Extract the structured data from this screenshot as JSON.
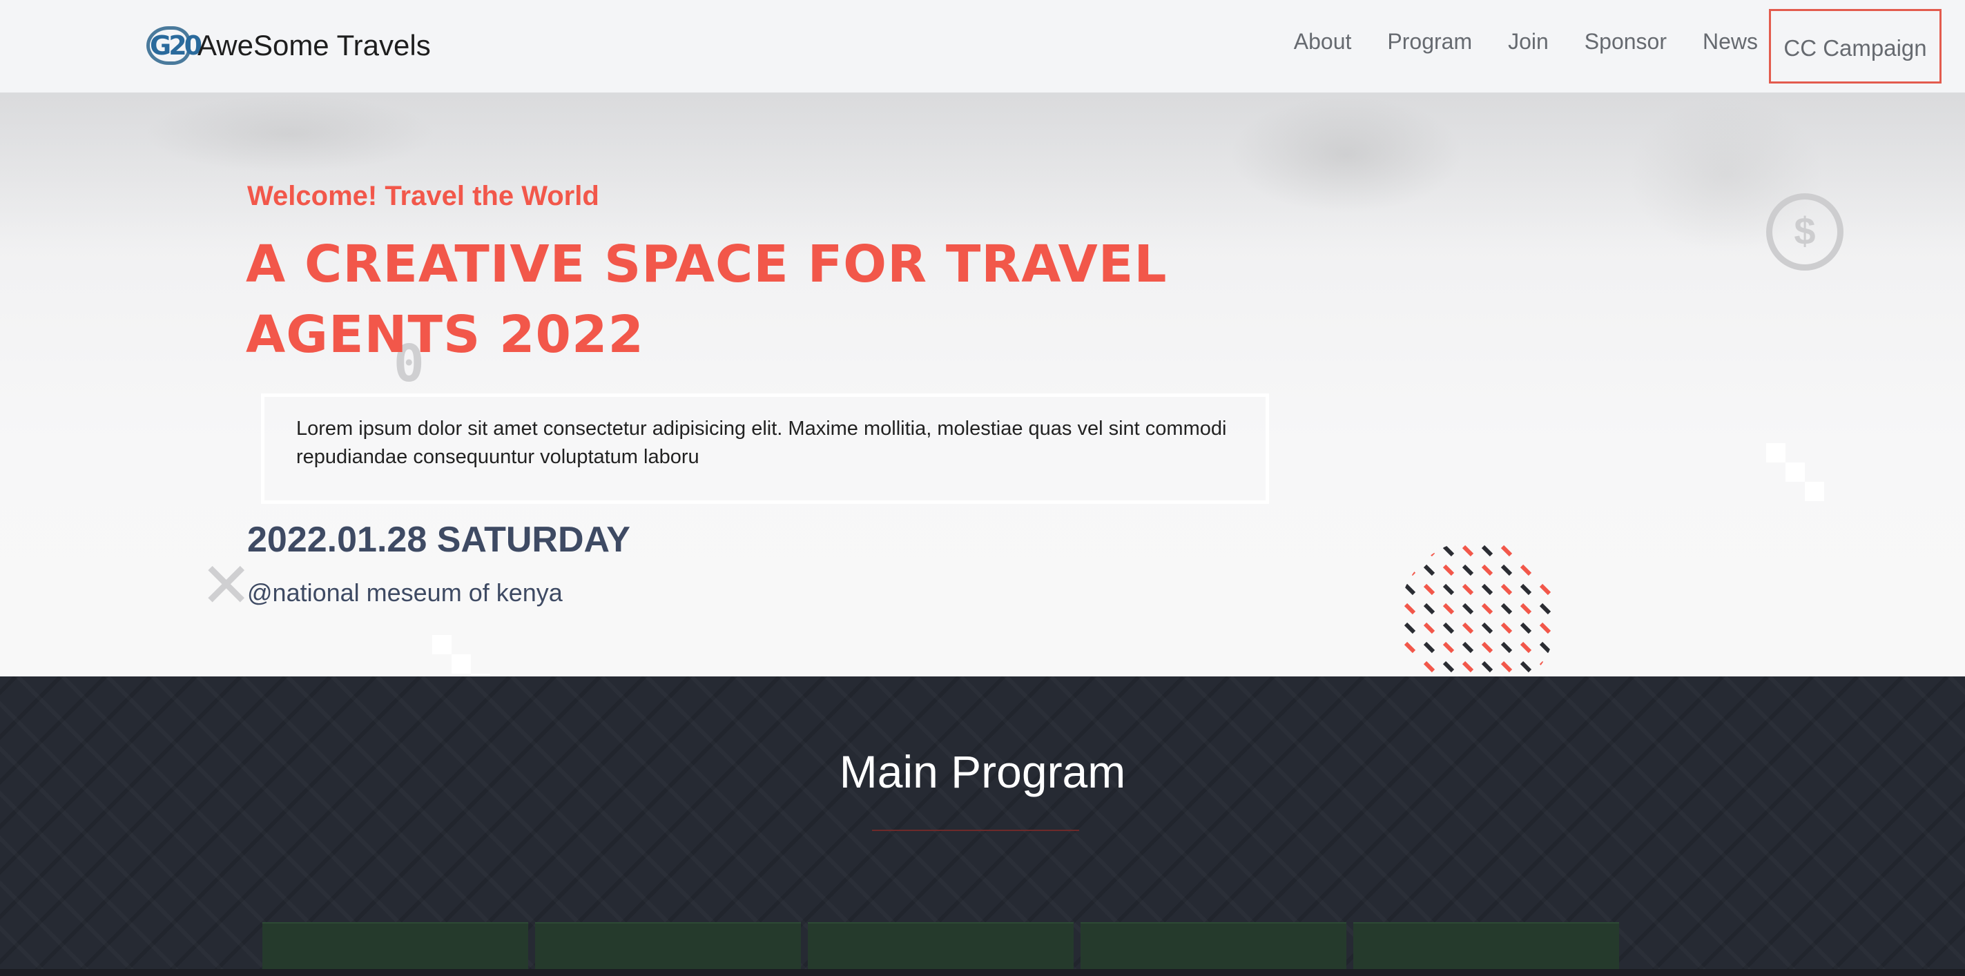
{
  "brand": {
    "logo_mark": "G20",
    "name": "AweSome Travels"
  },
  "nav": {
    "items": [
      "About",
      "Program",
      "Join",
      "Sponsor",
      "News"
    ],
    "cta": "CC Campaign"
  },
  "hero": {
    "subtitle": "Welcome! Travel the World",
    "headline": "A CREATIVE SPACE FOR TRAVEL AGENTS 2022",
    "description": "Lorem ipsum dolor sit amet consectetur adipisicing elit. Maxime mollitia, molestiae quas vel sint commodi repudiandae consequuntur voluptatum laboru",
    "date": "2022.01.28 SATURDAY",
    "venue": "@national meseum of kenya"
  },
  "program": {
    "title": "Main Program",
    "card_count": 5
  },
  "colors": {
    "accent": "#f2574a",
    "date_text": "#3e4a63",
    "dark_section": "#262a33",
    "cta_border": "#e35b4e"
  }
}
